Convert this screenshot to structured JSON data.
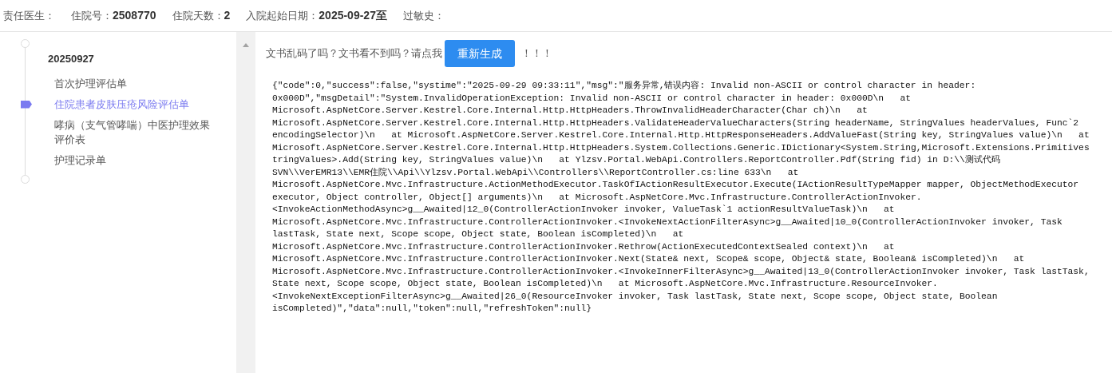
{
  "header": [
    {
      "label": "责任医生："
    },
    {
      "label": "住院号：",
      "value": "2508770"
    },
    {
      "label": "住院天数：",
      "value": "2"
    },
    {
      "label": "入院起始日期：",
      "value": "2025-09-27至"
    },
    {
      "label": "过敏史："
    }
  ],
  "sidebar": {
    "date": "20250927",
    "items": [
      {
        "label": "首次护理评估单",
        "selected": false
      },
      {
        "label": "住院患者皮肤压疮风险评估单",
        "selected": true
      },
      {
        "label": "哮病（支气管哮喘）中医护理效果评价表",
        "selected": false
      },
      {
        "label": "护理记录单",
        "selected": false
      }
    ]
  },
  "notice": {
    "text": "文书乱码了吗？文书看不到吗？请点我",
    "button": "重新生成",
    "suffix": "！！！"
  },
  "response_lines": [
    "{\"code\":0,\"success\":false,\"systime\":\"2025-09-29 09:33:11\",\"msg\":\"服务异常,错误内容: Invalid non-ASCII or control character in header:",
    "0x000D\",\"msgDetail\":\"System.InvalidOperationException: Invalid non-ASCII or control character in header: 0x000D\\n   at",
    "Microsoft.AspNetCore.Server.Kestrel.Core.Internal.Http.HttpHeaders.ThrowInvalidHeaderCharacter(Char ch)\\n   at",
    "Microsoft.AspNetCore.Server.Kestrel.Core.Internal.Http.HttpHeaders.ValidateHeaderValueCharacters(String headerName, StringValues headerValues, Func`2",
    "encodingSelector)\\n   at Microsoft.AspNetCore.Server.Kestrel.Core.Internal.Http.HttpResponseHeaders.AddValueFast(String key, StringValues value)\\n   at",
    "Microsoft.AspNetCore.Server.Kestrel.Core.Internal.Http.HttpHeaders.System.Collections.Generic.IDictionary<System.String,Microsoft.Extensions.Primitives",
    "tringValues>.Add(String key, StringValues value)\\n   at Ylzsv.Portal.WebApi.Controllers.ReportController.Pdf(String fid) in D:\\\\测试代码",
    "SVN\\\\VerEMR13\\\\EMR住院\\\\Api\\\\Ylzsv.Portal.WebApi\\\\Controllers\\\\ReportController.cs:line 633\\n   at",
    "Microsoft.AspNetCore.Mvc.Infrastructure.ActionMethodExecutor.TaskOfIActionResultExecutor.Execute(IActionResultTypeMapper mapper, ObjectMethodExecutor",
    "executor, Object controller, Object[] arguments)\\n   at Microsoft.AspNetCore.Mvc.Infrastructure.ControllerActionInvoker.",
    "<InvokeActionMethodAsync>g__Awaited|12_0(ControllerActionInvoker invoker, ValueTask`1 actionResultValueTask)\\n   at",
    "Microsoft.AspNetCore.Mvc.Infrastructure.ControllerActionInvoker.<InvokeNextActionFilterAsync>g__Awaited|10_0(ControllerActionInvoker invoker, Task",
    "lastTask, State next, Scope scope, Object state, Boolean isCompleted)\\n   at",
    "Microsoft.AspNetCore.Mvc.Infrastructure.ControllerActionInvoker.Rethrow(ActionExecutedContextSealed context)\\n   at",
    "Microsoft.AspNetCore.Mvc.Infrastructure.ControllerActionInvoker.Next(State& next, Scope& scope, Object& state, Boolean& isCompleted)\\n   at",
    "Microsoft.AspNetCore.Mvc.Infrastructure.ControllerActionInvoker.<InvokeInnerFilterAsync>g__Awaited|13_0(ControllerActionInvoker invoker, Task lastTask,",
    "State next, Scope scope, Object state, Boolean isCompleted)\\n   at Microsoft.AspNetCore.Mvc.Infrastructure.ResourceInvoker.",
    "<InvokeNextExceptionFilterAsync>g__Awaited|26_0(ResourceInvoker invoker, Task lastTask, State next, Scope scope, Object state, Boolean",
    "isCompleted)\",\"data\":null,\"token\":null,\"refreshToken\":null}"
  ]
}
